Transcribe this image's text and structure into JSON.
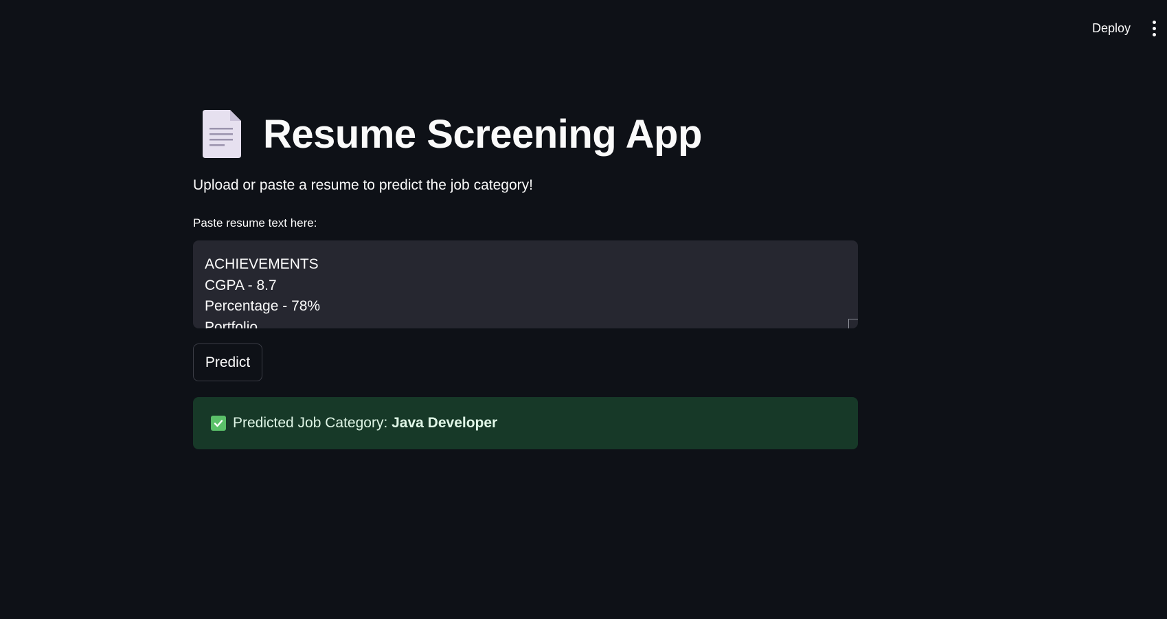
{
  "header": {
    "deploy_label": "Deploy",
    "menu_icon": "vertical-ellipsis-icon"
  },
  "main": {
    "title_icon": "page-facing-up-icon",
    "title": "Resume Screening App",
    "subtitle": "Upload or paste a resume to predict the job category!",
    "input": {
      "label": "Paste resume text here:",
      "lines": [
        "ACHIEVEMENTS",
        "CGPA - 8.7",
        "Percentage - 78%",
        "Portfolio"
      ]
    },
    "predict_label": "Predict",
    "result": {
      "icon": "check-mark-button-icon",
      "prefix": "Predicted Job Category: ",
      "value": "Java Developer"
    }
  },
  "colors": {
    "background": "#0e1117",
    "input_background": "#262730",
    "success_background": "#173928",
    "check_green": "#5bc069"
  }
}
